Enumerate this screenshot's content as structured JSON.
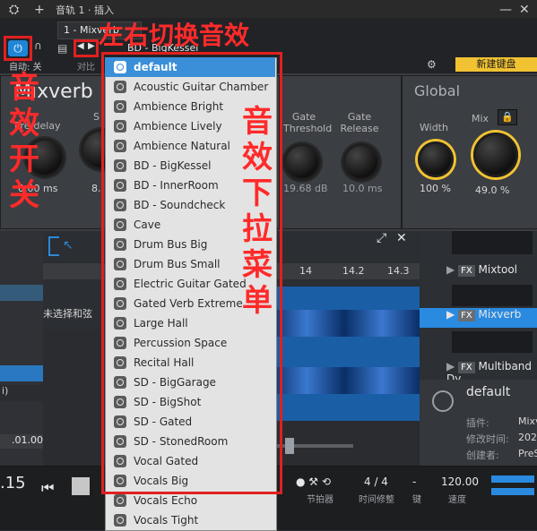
{
  "topbar": {
    "title": "音轨 1 · 插入",
    "annotation_arrows": "左右切换音效"
  },
  "plugin": {
    "slot": "1 - Mixverb",
    "preset": "BD - BigKessel",
    "auto_label": "自动: 关",
    "compare_label": "对比",
    "create_label": "创建",
    "keyboard_label": "新建键盘",
    "name": "Mixverb",
    "global_title": "Global",
    "knobs": {
      "predelay_label": "Pre-delay",
      "predelay_value": "0.00 ms",
      "s_label": "S",
      "s_value": "8.",
      "gate_threshold_label": "Gate\nThreshold",
      "gate_threshold_value": "19.68 dB",
      "gate_release_label": "Gate\nRelease",
      "gate_release_value": "10.0 ms",
      "width_label": "Width",
      "width_value": "100 %",
      "mix_label": "Mix",
      "mix_value": "49.0 %"
    },
    "left_annotation": [
      "音",
      "效",
      "开",
      "关"
    ],
    "menu_annotation": [
      "音",
      "效",
      "下",
      "拉",
      "菜",
      "单"
    ]
  },
  "menu": {
    "items": [
      "default",
      "Acoustic Guitar Chamber",
      "Ambience Bright",
      "Ambience Lively",
      "Ambience Natural",
      "BD - BigKessel",
      "BD - InnerRoom",
      "BD - Soundcheck",
      "Cave",
      "Drum Bus Big",
      "Drum Bus Small",
      "Electric Guitar Gated",
      "Gated Verb Extreme",
      "Large Hall",
      "Percussion Space",
      "Recital Hall",
      "SD - BigGarage",
      "SD - BigShot",
      "SD - Gated",
      "SD - StonedRoom",
      "Vocal Gated",
      "Vocals Big",
      "Vocals Echo",
      "Vocals Tight"
    ]
  },
  "arrange": {
    "ruler": [
      "14",
      "14.2",
      "14.3"
    ],
    "left_text": "未选择和弦"
  },
  "right_panel": {
    "items": [
      "Mixtool",
      "Mixverb",
      "Multiband Dy"
    ],
    "preset_title": "default",
    "meta": [
      {
        "label": "插件:",
        "value": "Mixv"
      },
      {
        "label": "修改时间:",
        "value": "2020"
      },
      {
        "label": "创建者:",
        "value": "PreS"
      }
    ]
  },
  "bottom": {
    "time": ".15",
    "left_value": ".01.00",
    "left_unit": "i)",
    "metronome": "节拍器",
    "time_sig": "4 / 4",
    "time_sig_label": "时间修整",
    "key_value": "-",
    "key_label": "键",
    "tempo": "120.00",
    "tempo_label": "速度"
  }
}
